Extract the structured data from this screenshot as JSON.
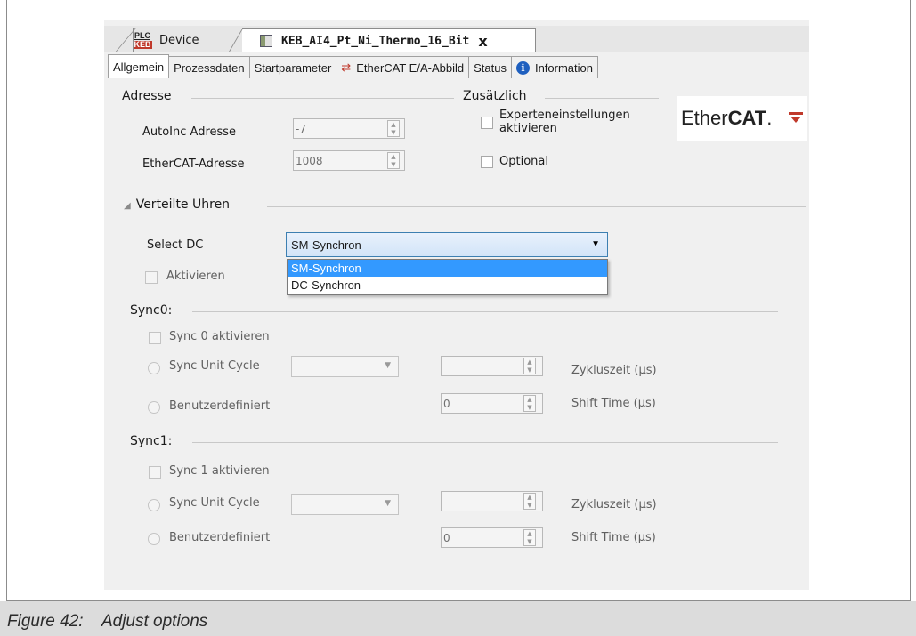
{
  "doc_tabs": {
    "device": {
      "icon_top": "PLC",
      "icon_bottom": "KEB",
      "label": "Device"
    },
    "active": {
      "label": "KEB_AI4_Pt_Ni_Thermo_16_Bit",
      "close": "x"
    }
  },
  "sub_tabs": [
    "Allgemein",
    "Prozessdaten",
    "Startparameter",
    "EtherCAT E/A-Abbild",
    "Status",
    "Information"
  ],
  "adresse": {
    "title": "Adresse",
    "autoinc_label": "AutoInc Adresse",
    "autoinc_value": "-7",
    "ethercat_label": "EtherCAT-Adresse",
    "ethercat_value": "1008"
  },
  "zusaetzlich": {
    "title": "Zusätzlich",
    "experten_line1": "Experteneinstellungen",
    "experten_line2": "aktivieren",
    "optional": "Optional"
  },
  "logo": {
    "prefix": "Ether",
    "bold": "CAT",
    "mark": "."
  },
  "verteilte_uhren": {
    "title": "Verteilte Uhren",
    "select_label": "Select DC",
    "selected": "SM-Synchron",
    "options": [
      "SM-Synchron",
      "DC-Synchron"
    ],
    "aktivieren": "Aktivieren"
  },
  "sync0": {
    "title": "Sync0:",
    "enable": "Sync 0 aktivieren",
    "unit_cycle": "Sync Unit Cycle",
    "custom": "Benutzerdefiniert",
    "cycle_time": "Zykluszeit (µs)",
    "shift_time": "Shift Time (µs)",
    "shift_value": "0"
  },
  "sync1": {
    "title": "Sync1:",
    "enable": "Sync 1 aktivieren",
    "unit_cycle": "Sync Unit Cycle",
    "custom": "Benutzerdefiniert",
    "cycle_time": "Zykluszeit (µs)",
    "shift_time": "Shift Time (µs)",
    "shift_value": "0"
  },
  "caption": {
    "text": "Figure 42:    Adjust options"
  }
}
